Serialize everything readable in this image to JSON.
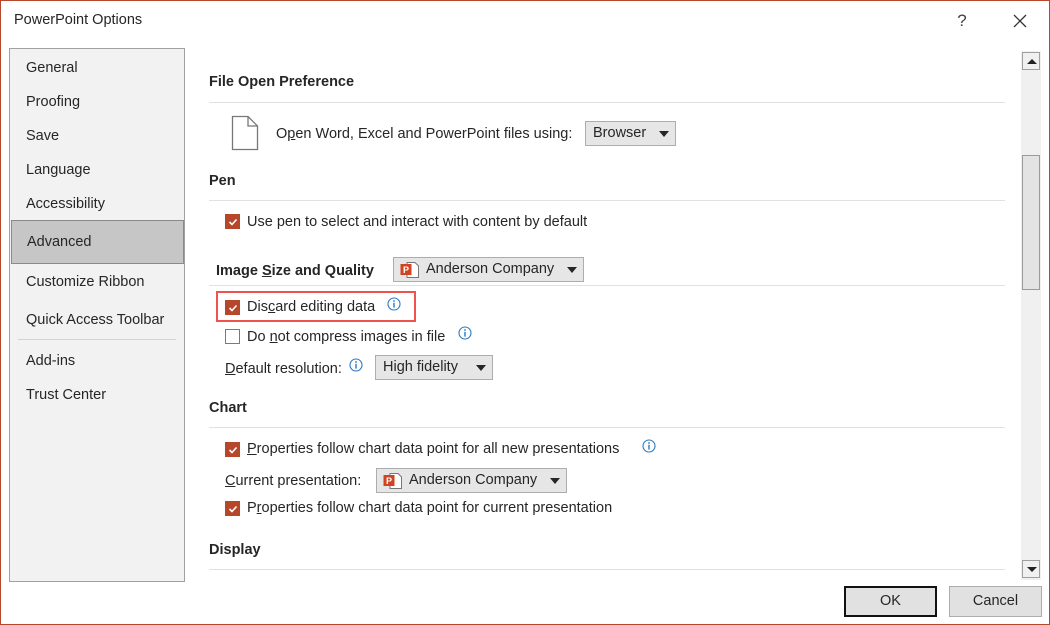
{
  "window": {
    "title": "PowerPoint Options",
    "help_label": "?",
    "close_icon": "close-icon"
  },
  "nav": {
    "items": [
      {
        "label": "General",
        "selected": false
      },
      {
        "label": "Proofing",
        "selected": false
      },
      {
        "label": "Save",
        "selected": false
      },
      {
        "label": "Language",
        "selected": false
      },
      {
        "label": "Accessibility",
        "selected": false
      },
      {
        "label": "Advanced",
        "selected": true
      },
      {
        "label": "Customize Ribbon",
        "selected": false
      },
      {
        "label": "Quick Access Toolbar",
        "selected": false
      },
      {
        "label": "Add-ins",
        "selected": false
      },
      {
        "label": "Trust Center",
        "selected": false
      }
    ]
  },
  "sections": {
    "file_open": {
      "title": "File Open Preference",
      "icon": "document-icon",
      "label_pre": "O",
      "label_u": "p",
      "label_post": "en Word, Excel and PowerPoint files using:",
      "dropdown_value": "Browser"
    },
    "pen": {
      "title": "Pen",
      "use_pen_label": "Use pen to select and interact with content by default",
      "use_pen_checked": true
    },
    "image": {
      "title_pre": "Image ",
      "title_u": "S",
      "title_post": "ize and Quality",
      "presentation_dropdown": "Anderson Company",
      "discard_pre": "Dis",
      "discard_u": "c",
      "discard_post": "ard editing data",
      "discard_checked": true,
      "no_compress_pre": "Do ",
      "no_compress_u": "n",
      "no_compress_post": "ot compress images in file",
      "no_compress_checked": false,
      "resolution_u": "D",
      "resolution_post": "efault resolution:",
      "resolution_value": "High fidelity"
    },
    "chart": {
      "title": "Chart",
      "all_new_u": "P",
      "all_new_post": "roperties follow chart data point for all new presentations",
      "all_new_checked": true,
      "current_u": "C",
      "current_post": "urrent presentation:",
      "current_dropdown": "Anderson Company",
      "current_pres_pre": "P",
      "current_pres_u": "r",
      "current_pres_post": "operties follow chart data point for current presentation",
      "current_pres_checked": true
    },
    "display": {
      "title": "Display"
    }
  },
  "footer": {
    "ok_label": "OK",
    "cancel_label": "Cancel"
  },
  "colors": {
    "accent": "#b7472a",
    "highlight": "#f0524e",
    "info": "#2b79c2"
  }
}
